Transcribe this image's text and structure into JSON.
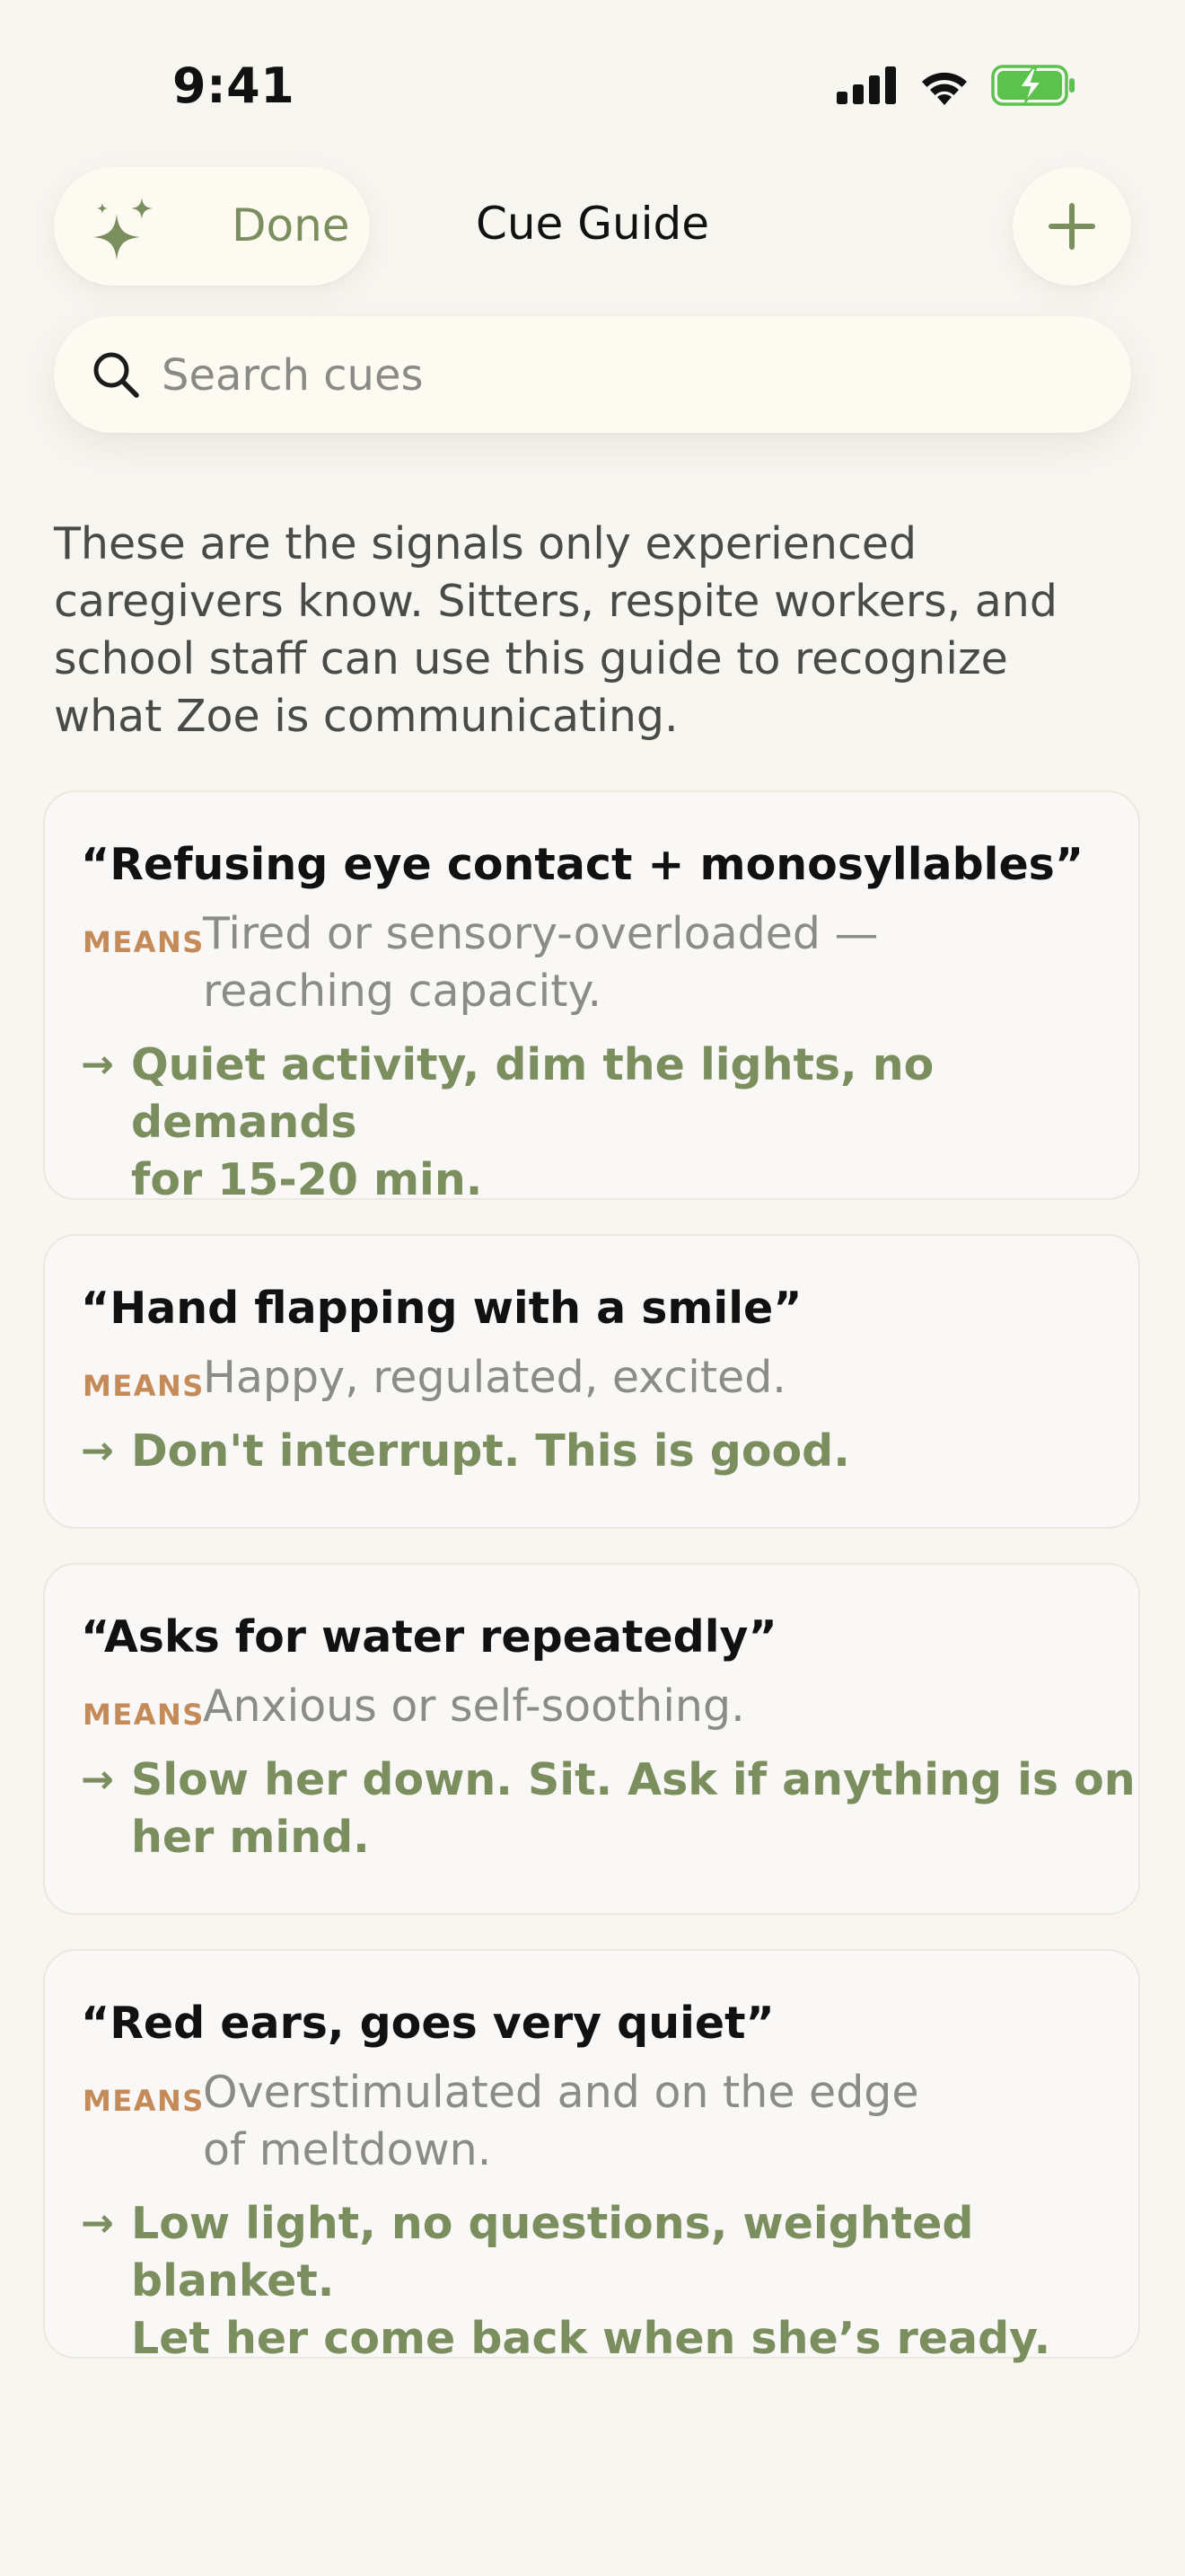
{
  "status_bar": {
    "time": "9:41"
  },
  "header": {
    "done_label": "Done",
    "title": "Cue Guide",
    "icons": [
      "sparkle-icon",
      "plus-icon"
    ]
  },
  "search": {
    "placeholder": "Search cues",
    "value": ""
  },
  "intro": "These are the signals only experienced caregivers know. Sitters, respite workers, and school staff can use this guide to recognize what Zoe is communicating.",
  "cards": [
    {
      "title": "“Refusing eye contact + monosyllables”",
      "means_label": "MEANS",
      "means_line1": "Tired or sensory-overloaded —",
      "means_line2": "reaching capacity.",
      "arrow": "→",
      "action_line1": "Quiet activity, dim the lights, no demands",
      "action_line2": "for 15-20 min."
    },
    {
      "title": "“Hand flapping with a smile”",
      "means_label": "MEANS",
      "means_line1": "Happy, regulated, excited.",
      "arrow": "→",
      "action_line1": "Don't interrupt. This is good."
    },
    {
      "title": "“Asks for water repeatedly”",
      "means_label": "MEANS",
      "means_line1": "Anxious or self-soothing.",
      "arrow": "→",
      "action_line1": "Slow her down. Sit. Ask if anything is on",
      "action_line2": "her mind."
    },
    {
      "title": "“Red ears, goes very quiet”",
      "means_label": "MEANS",
      "means_line1": "Overstimulated and on the edge",
      "means_line2": "of meltdown.",
      "arrow": "→",
      "action_line1": "Low light, no questions, weighted blanket.",
      "action_line2": "Let her come back when she’s ready."
    }
  ],
  "colors": {
    "background": "#f8f6f1",
    "accent_green": "#7a8e5e",
    "means_orange": "#c48a58",
    "card_bg": "#f9f8f6",
    "battery_green": "#5cc24e"
  }
}
